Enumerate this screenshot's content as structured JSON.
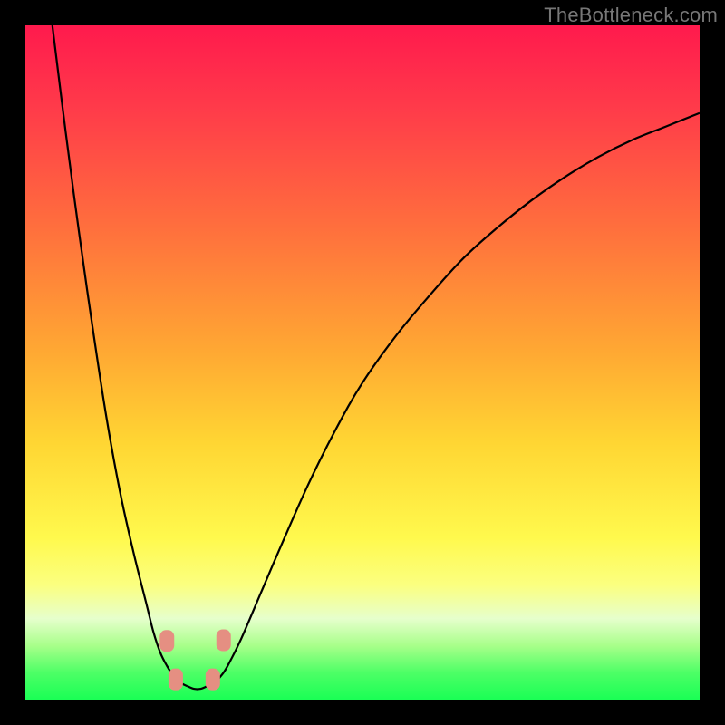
{
  "watermark": "TheBottleneck.com",
  "colors": {
    "background": "#000000",
    "curve": "#000000",
    "marker_fill": "#e58f82",
    "marker_stroke": "#c9776a"
  },
  "chart_data": {
    "type": "line",
    "title": "",
    "xlabel": "",
    "ylabel": "",
    "xlim": [
      0,
      100
    ],
    "ylim": [
      0,
      100
    ],
    "grid": false,
    "legend": false,
    "annotations": [],
    "series": [
      {
        "name": "left-branch",
        "x": [
          4,
          6,
          8,
          10,
          12,
          14,
          16,
          18,
          19,
          20,
          21,
          22,
          23,
          24
        ],
        "y": [
          100,
          84,
          69,
          55,
          42,
          31,
          22,
          14,
          10,
          7,
          5,
          3.5,
          2.5,
          2
        ]
      },
      {
        "name": "right-branch",
        "x": [
          27,
          28,
          29,
          30,
          32,
          35,
          38,
          42,
          46,
          50,
          55,
          60,
          65,
          70,
          75,
          80,
          85,
          90,
          95,
          100
        ],
        "y": [
          2,
          2.5,
          3.5,
          5,
          9,
          16,
          23,
          32,
          40,
          47,
          54,
          60,
          65.5,
          70,
          74,
          77.5,
          80.5,
          83,
          85,
          87
        ]
      }
    ],
    "valley": {
      "x": [
        24,
        25,
        26,
        27
      ],
      "y": [
        2,
        1.6,
        1.6,
        2
      ]
    },
    "markers": [
      {
        "x": 21.0,
        "y": 8.7
      },
      {
        "x": 22.3,
        "y": 3.0
      },
      {
        "x": 27.8,
        "y": 3.0
      },
      {
        "x": 29.4,
        "y": 8.8
      }
    ]
  }
}
